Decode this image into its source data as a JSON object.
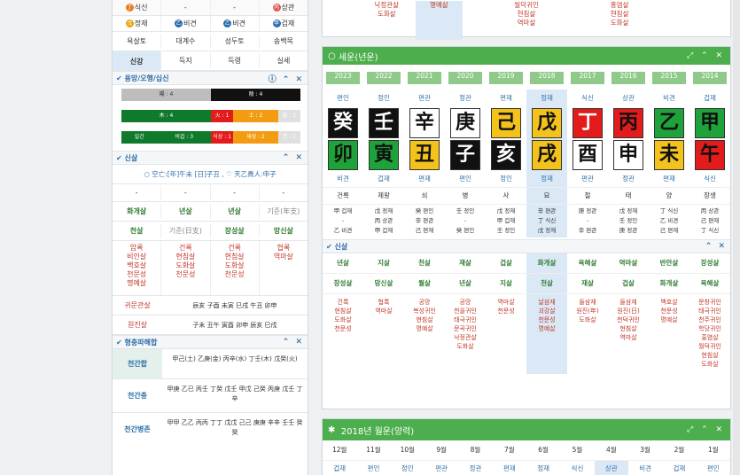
{
  "left": {
    "top_rows": [
      [
        "식신",
        "-",
        "-",
        "상관"
      ],
      [
        "정재",
        "비견",
        "비견",
        "겁재"
      ]
    ],
    "gods_row": [
      "욕살토",
      "대계수",
      "성두토",
      "송백목"
    ],
    "stage_row": [
      "신강",
      "득지",
      "득령",
      "실세"
    ],
    "section_yongmang": "용망/오행/십신",
    "bars": {
      "row1": [
        "陽 : 4",
        "陰 : 4"
      ],
      "row2": [
        "木 : 4",
        "火 : 1",
        "土 : 2",
        "金 : 1"
      ],
      "row3": [
        "일간",
        "비겁 : 3",
        "식상 : 1",
        "재성 : 2",
        "관 : 1"
      ]
    },
    "section_sinsal": "신살",
    "sinsal_line": "○ 空亡:[年]午未 [日]子丑 , ♡ 天乙貴人:申子",
    "dash_row": [
      "-",
      "-",
      "-",
      "-"
    ],
    "r1": [
      "화개살",
      "년살",
      "년살",
      "기준(年支)"
    ],
    "r2": [
      "천살",
      "기준(日支)",
      "장성살",
      "망신살"
    ],
    "r3": [
      "암록\n비인살\n백호살\n천문성\n명예살",
      "건록\n현침살\n도화살\n천문성",
      "건록\n현침살\n도화살\n천문성",
      "협록\n역마살"
    ],
    "gwiin_label": "귀문관살",
    "gwiin_val": "辰亥 子酉 未寅 巳戌 午丑 卯申",
    "wonjin_label": "원진살",
    "wonjin_val": "子未 丑午 寅酉 卯申 辰亥 巳戌",
    "section_hyeong": "형충파해합",
    "hap1_label": "천간합",
    "hap1_val": "甲己(土) 乙庚(金) 丙辛(水) 丁壬(木) 戊癸(火)",
    "hap2_label": "천간충",
    "hap2_val": "甲庚 乙已 丙壬 丁癸 戊壬 甲戊 己癸 丙庚 戊壬 丁辛",
    "hap3_label": "천간병존",
    "hap3_val": "甲甲 乙乙 丙丙 丁丁 戊戊 己己 庚庚 辛辛 壬壬 癸癸"
  },
  "top_frag": {
    "c1": "낙정관살\n도화살",
    "c2": "명예살",
    "c3": "월덕귀인\n현침살\n역마살",
    "c4": "홍염살\n현침살\n도화살"
  },
  "seun": {
    "title": "세운(년운)",
    "accent": "#4cae4c",
    "years": [
      "2023",
      "2022",
      "2021",
      "2020",
      "2019",
      "2018",
      "2017",
      "2016",
      "2015",
      "2014"
    ],
    "top_gods": [
      "편인",
      "정인",
      "편관",
      "정관",
      "편재",
      "정재",
      "식신",
      "상관",
      "비견",
      "겁재"
    ],
    "stems": [
      "癸",
      "壬",
      "辛",
      "庚",
      "己",
      "戊",
      "丁",
      "丙",
      "乙",
      "甲"
    ],
    "branches": [
      "卯",
      "寅",
      "丑",
      "子",
      "亥",
      "戌",
      "酉",
      "申",
      "未",
      "午"
    ],
    "bottom_gods": [
      "비견",
      "겁재",
      "편재",
      "편인",
      "정인",
      "정재",
      "편관",
      "정관",
      "편재",
      "식신"
    ],
    "stages": [
      "건록",
      "제왕",
      "쇠",
      "병",
      "사",
      "묘",
      "절",
      "태",
      "양",
      "장생"
    ],
    "hidden": [
      "甲 겁재\n-\n乙 비견",
      "戊 정재\n丙 상관\n甲 겁재",
      "癸 편인\n辛 편관\n己 편재",
      "壬 정인\n-\n癸 편인",
      "戊 정재\n甲 겁재\n壬 정인",
      "辛 편관\n丁 식신\n戊 정재",
      "庚 정관\n-\n辛 편관",
      "戊 정재\n壬 정인\n庚 정관",
      "丁 식신\n乙 비견\n己 편재",
      "丙 상관\n己 편재\n丁 식신"
    ]
  },
  "sinsal2": {
    "title": "신살",
    "r1": [
      "년살",
      "지살",
      "천살",
      "재살",
      "겁살",
      "화개살",
      "육해살",
      "역마살",
      "반안살",
      "장성살"
    ],
    "r2": [
      "장성살",
      "망신살",
      "월살",
      "년살",
      "지살",
      "천살",
      "재살",
      "겁살",
      "화개살",
      "육해살"
    ],
    "r3": [
      "건록\n현침살\n도화살\n천문성",
      "협록\n역마살",
      "공망\n복성귀인\n현침살\n명예살",
      "공망\n천을귀인\n태극귀인\n문곡귀인\n낙정관살\n도화살",
      "역마살\n천문성",
      "날삼재\n괴강살\n천문성\n명예살",
      "들삼재\n원진(年)\n도화살",
      "들삼재\n원진(日)\n천덕귀인\n현침살\n역마살",
      "백호살\n천문성\n명예살",
      "문창귀인\n태극귀인\n천주귀인\n학당귀인\n홍염살\n월덕귀인\n현침살\n도화살"
    ]
  },
  "woleun": {
    "title": "2018년 월운(양력)",
    "months": [
      "12월",
      "11월",
      "10월",
      "9월",
      "8월",
      "7월",
      "6월",
      "5월",
      "4월",
      "3월",
      "2월",
      "1월"
    ],
    "gods": [
      "겁재",
      "편인",
      "정인",
      "편관",
      "정관",
      "편재",
      "정재",
      "식신",
      "상관",
      "비견",
      "겁재",
      "편인"
    ]
  }
}
